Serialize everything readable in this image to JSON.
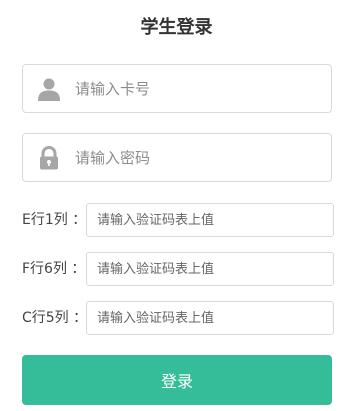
{
  "title": "学生登录",
  "card_field": {
    "icon": "user-icon",
    "placeholder": "请输入卡号",
    "value": ""
  },
  "password_field": {
    "icon": "lock-icon",
    "placeholder": "请输入密码",
    "value": ""
  },
  "captcha_rows": [
    {
      "label": "E行1列 ：",
      "placeholder": "请输入验证码表上值",
      "value": ""
    },
    {
      "label": "F行6列 ：",
      "placeholder": "请输入验证码表上值",
      "value": ""
    },
    {
      "label": "C行5列 ：",
      "placeholder": "请输入验证码表上值",
      "value": ""
    }
  ],
  "login_button": {
    "label": "登录"
  },
  "colors": {
    "accent": "#35bd9a",
    "icon_gray": "#a6a6a6",
    "border": "#d9d9d9"
  }
}
